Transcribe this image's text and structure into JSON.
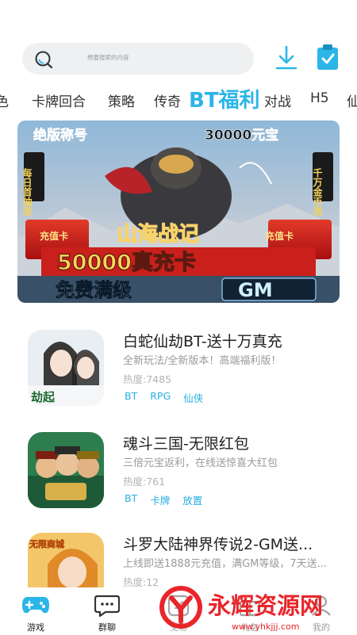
{
  "search": {
    "placeholder": "想要搜索的内容"
  },
  "tabs": [
    {
      "label": "色"
    },
    {
      "label": "卡牌回合"
    },
    {
      "label": "策略"
    },
    {
      "label": "传奇"
    },
    {
      "label": "BT福利",
      "active": true
    },
    {
      "label": "对战"
    },
    {
      "label": "H5"
    },
    {
      "label": "仙"
    }
  ],
  "banner": {
    "top_left": "绝版称号",
    "top_right": "30000元宝",
    "left_side": "每日首抽送",
    "right_side": "千万金币送",
    "logo": "山海战记",
    "card_left": "充值卡",
    "card_right": "充值卡",
    "headline": "50000真充卡",
    "subline_left": "免费满级",
    "subline_right": "GM"
  },
  "games": [
    {
      "title": "白蛇仙劫BT-送十万真充",
      "desc": "全新玩法/全新版本！高端福利版！",
      "heat": "热度:7485",
      "tags": [
        "BT",
        "RPG",
        "仙侠"
      ],
      "icon_text": "劫起"
    },
    {
      "title": "魂斗三国-无限红包",
      "desc": "三倍元宝返利，在线送惊喜大红包",
      "heat": "热度:761",
      "tags": [
        "BT",
        "卡牌",
        "放置"
      ],
      "icon_text": ""
    },
    {
      "title": "斗罗大陆神界传说2-GM送...",
      "desc": "上线即送1888元充值，满GM等级，7天送...",
      "heat": "热度:12",
      "tags": [],
      "icon_text": "无限商城"
    }
  ],
  "nav": [
    {
      "label": "游戏",
      "icon": "gamepad-icon"
    },
    {
      "label": "群聊",
      "icon": "chat-icon"
    },
    {
      "label": "交易",
      "icon": "trade-icon"
    },
    {
      "label": "礼包",
      "icon": "gift-icon"
    },
    {
      "label": "我的",
      "icon": "user-icon"
    }
  ],
  "watermark": {
    "text": "永辉资源网",
    "url": "www.yhkjjj.com"
  },
  "colors": {
    "accent": "#2bb5e8",
    "tag": "#2aaee0",
    "watermark_red": "#e8262b"
  }
}
